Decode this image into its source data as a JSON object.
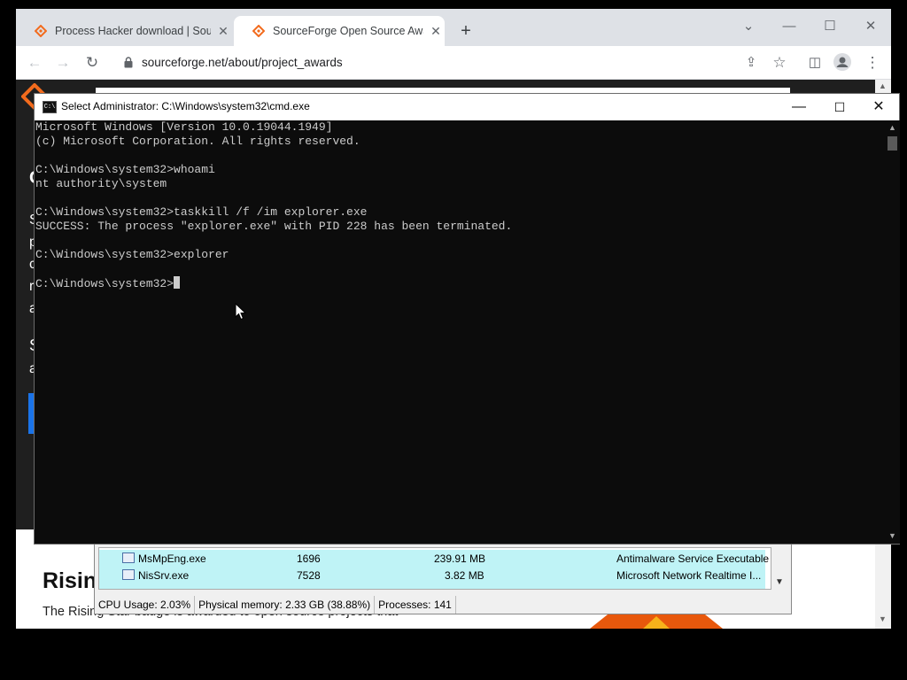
{
  "browser": {
    "tabs": [
      {
        "title": "Process Hacker download | Sourc",
        "active": false
      },
      {
        "title": "SourceForge Open Source Award",
        "active": true
      }
    ],
    "new_tab_label": "+",
    "url": "sourceforge.net/about/project_awards"
  },
  "site": {
    "heading": "Rising",
    "paragraph": "The Rising Star badge is awarded to open source projects that"
  },
  "process_hacker": {
    "rows": [
      {
        "name": "MsMpEng.exe",
        "pid": "1696",
        "memory": "239.91 MB",
        "description": "Antimalware Service Executable"
      },
      {
        "name": "NisSrv.exe",
        "pid": "7528",
        "memory": "3.82 MB",
        "description": "Microsoft Network Realtime I..."
      }
    ],
    "status": {
      "cpu": "CPU Usage: 2.03%",
      "memory": "Physical memory: 2.33 GB (38.88%)",
      "processes": "Processes: 141"
    }
  },
  "cmd": {
    "title": "Select Administrator: C:\\Windows\\system32\\cmd.exe",
    "lines": [
      "Microsoft Windows [Version 10.0.19044.1949]",
      "(c) Microsoft Corporation. All rights reserved.",
      "",
      "C:\\Windows\\system32>whoami",
      "nt authority\\system",
      "",
      "C:\\Windows\\system32>taskkill /f /im explorer.exe",
      "SUCCESS: The process \"explorer.exe\" with PID 228 has been terminated.",
      "",
      "C:\\Windows\\system32>explorer",
      "",
      "C:\\Windows\\system32>"
    ]
  },
  "colors": {
    "cmd_background": "#0c0c0c",
    "cmd_text": "#cccccc",
    "process_highlight": "#bff3f6",
    "sourceforge_orange": "#f26b1d"
  }
}
